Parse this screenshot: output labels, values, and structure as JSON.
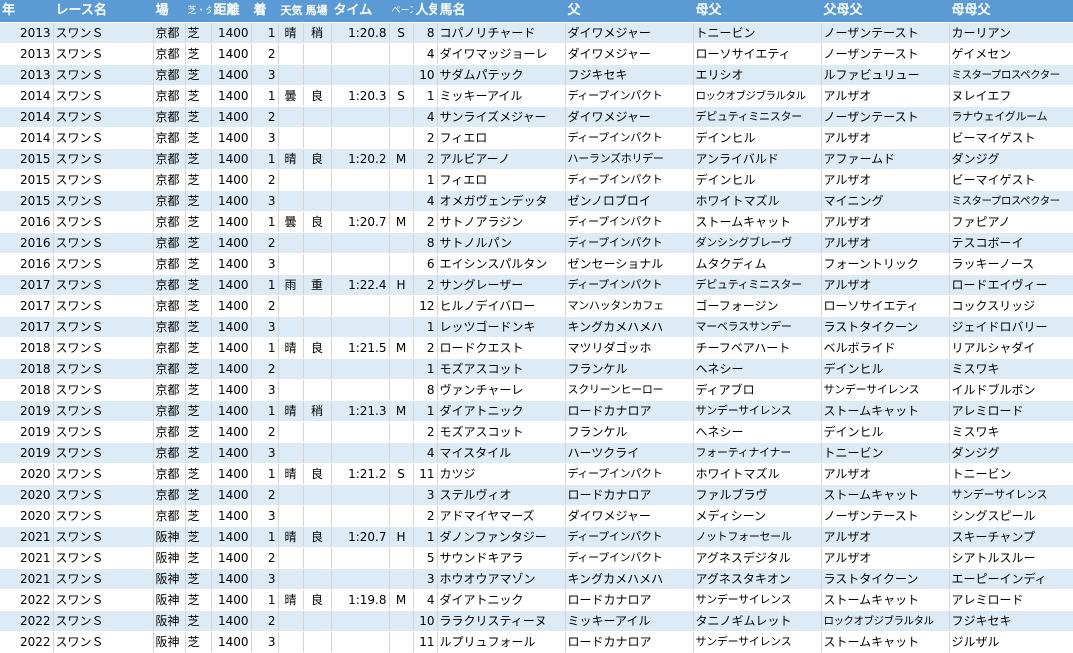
{
  "columns": [
    "年",
    "レース名",
    "場",
    "芝・ダ",
    "距離",
    "着",
    "天気",
    "馬場",
    "タイム",
    "ペース",
    "人気",
    "馬名",
    "父",
    "母父",
    "父母父",
    "母母父"
  ],
  "rows": [
    [
      "2013",
      "スワンＳ",
      "京都",
      "芝",
      "1400",
      "1",
      "晴",
      "稍",
      "1:20.8",
      "S",
      "8",
      "コパノリチャード",
      "ダイワメジャー",
      "トニービン",
      "ノーザンテースト",
      "カーリアン"
    ],
    [
      "2013",
      "スワンＳ",
      "京都",
      "芝",
      "1400",
      "2",
      "",
      "",
      "",
      "",
      "4",
      "ダイワマッジョーレ",
      "ダイワメジャー",
      "ローソサイエティ",
      "ノーザンテースト",
      "ゲイメセン"
    ],
    [
      "2013",
      "スワンＳ",
      "京都",
      "芝",
      "1400",
      "3",
      "",
      "",
      "",
      "",
      "10",
      "サダムパテック",
      "フジキセキ",
      "エリシオ",
      "ルファビュリュー",
      "ミスタープロスペクター"
    ],
    [
      "2014",
      "スワンＳ",
      "京都",
      "芝",
      "1400",
      "1",
      "曇",
      "良",
      "1:20.3",
      "S",
      "1",
      "ミッキーアイル",
      "ディープインパクト",
      "ロックオブジブラルタル",
      "アルザオ",
      "ヌレイエフ"
    ],
    [
      "2014",
      "スワンＳ",
      "京都",
      "芝",
      "1400",
      "2",
      "",
      "",
      "",
      "",
      "4",
      "サンライズメジャー",
      "ダイワメジャー",
      "デピュティミニスター",
      "ノーザンテースト",
      "ラナウェイグルーム"
    ],
    [
      "2014",
      "スワンＳ",
      "京都",
      "芝",
      "1400",
      "3",
      "",
      "",
      "",
      "",
      "2",
      "フィエロ",
      "ディープインパクト",
      "デインヒル",
      "アルザオ",
      "ビーマイゲスト"
    ],
    [
      "2015",
      "スワンＳ",
      "京都",
      "芝",
      "1400",
      "1",
      "晴",
      "良",
      "1:20.2",
      "M",
      "2",
      "アルビアーノ",
      "ハーランズホリデー",
      "アンライバルド",
      "アファームド",
      "ダンジグ"
    ],
    [
      "2015",
      "スワンＳ",
      "京都",
      "芝",
      "1400",
      "2",
      "",
      "",
      "",
      "",
      "1",
      "フィエロ",
      "ディープインパクト",
      "デインヒル",
      "アルザオ",
      "ビーマイゲスト"
    ],
    [
      "2015",
      "スワンＳ",
      "京都",
      "芝",
      "1400",
      "3",
      "",
      "",
      "",
      "",
      "4",
      "オメガヴェンデッタ",
      "ゼンノロブロイ",
      "ホワイトマズル",
      "マイニング",
      "ミスタープロスペクター"
    ],
    [
      "2016",
      "スワンＳ",
      "京都",
      "芝",
      "1400",
      "1",
      "曇",
      "良",
      "1:20.7",
      "M",
      "2",
      "サトノアラジン",
      "ディープインパクト",
      "ストームキャット",
      "アルザオ",
      "ファピアノ"
    ],
    [
      "2016",
      "スワンＳ",
      "京都",
      "芝",
      "1400",
      "2",
      "",
      "",
      "",
      "",
      "8",
      "サトノルパン",
      "ディープインパクト",
      "ダンシングブレーヴ",
      "アルザオ",
      "テスコボーイ"
    ],
    [
      "2016",
      "スワンＳ",
      "京都",
      "芝",
      "1400",
      "3",
      "",
      "",
      "",
      "",
      "6",
      "エイシンスパルタン",
      "ゼンセーショナル",
      "ムタクディム",
      "フォーントリック",
      "ラッキーノース"
    ],
    [
      "2017",
      "スワンＳ",
      "京都",
      "芝",
      "1400",
      "1",
      "雨",
      "重",
      "1:22.4",
      "H",
      "2",
      "サングレーザー",
      "ディープインパクト",
      "デピュティミニスター",
      "アルザオ",
      "ロードエイヴィー"
    ],
    [
      "2017",
      "スワンＳ",
      "京都",
      "芝",
      "1400",
      "2",
      "",
      "",
      "",
      "",
      "12",
      "ヒルノデイバロー",
      "マンハッタンカフェ",
      "ゴーフォージン",
      "ローソサイエティ",
      "コックスリッジ"
    ],
    [
      "2017",
      "スワンＳ",
      "京都",
      "芝",
      "1400",
      "3",
      "",
      "",
      "",
      "",
      "1",
      "レッツゴードンキ",
      "キングカメハメハ",
      "マーベラスサンデー",
      "ラストタイクーン",
      "ジェイドロバリー"
    ],
    [
      "2018",
      "スワンＳ",
      "京都",
      "芝",
      "1400",
      "1",
      "晴",
      "良",
      "1:21.5",
      "M",
      "2",
      "ロードクエスト",
      "マツリダゴッホ",
      "チーフベアハート",
      "ベルボライド",
      "リアルシャダイ"
    ],
    [
      "2018",
      "スワンＳ",
      "京都",
      "芝",
      "1400",
      "2",
      "",
      "",
      "",
      "",
      "1",
      "モズアスコット",
      "フランケル",
      "ヘネシー",
      "デインヒル",
      "ミスワキ"
    ],
    [
      "2018",
      "スワンＳ",
      "京都",
      "芝",
      "1400",
      "3",
      "",
      "",
      "",
      "",
      "8",
      "ヴァンチャーレ",
      "スクリーンヒーロー",
      "ディアブロ",
      "サンデーサイレンス",
      "イルドブルボン"
    ],
    [
      "2019",
      "スワンＳ",
      "京都",
      "芝",
      "1400",
      "1",
      "晴",
      "稍",
      "1:21.3",
      "M",
      "1",
      "ダイアトニック",
      "ロードカナロア",
      "サンデーサイレンス",
      "ストームキャット",
      "アレミロード"
    ],
    [
      "2019",
      "スワンＳ",
      "京都",
      "芝",
      "1400",
      "2",
      "",
      "",
      "",
      "",
      "2",
      "モズアスコット",
      "フランケル",
      "ヘネシー",
      "デインヒル",
      "ミスワキ"
    ],
    [
      "2019",
      "スワンＳ",
      "京都",
      "芝",
      "1400",
      "3",
      "",
      "",
      "",
      "",
      "4",
      "マイスタイル",
      "ハーツクライ",
      "フォーティナイナー",
      "トニービン",
      "ダンジグ"
    ],
    [
      "2020",
      "スワンＳ",
      "京都",
      "芝",
      "1400",
      "1",
      "晴",
      "良",
      "1:21.2",
      "S",
      "11",
      "カツジ",
      "ディープインパクト",
      "ホワイトマズル",
      "アルザオ",
      "トニービン"
    ],
    [
      "2020",
      "スワンＳ",
      "京都",
      "芝",
      "1400",
      "2",
      "",
      "",
      "",
      "",
      "3",
      "ステルヴィオ",
      "ロードカナロア",
      "ファルブラヴ",
      "ストームキャット",
      "サンデーサイレンス"
    ],
    [
      "2020",
      "スワンＳ",
      "京都",
      "芝",
      "1400",
      "3",
      "",
      "",
      "",
      "",
      "2",
      "アドマイヤマーズ",
      "ダイワメジャー",
      "メディシーン",
      "ノーザンテースト",
      "シングスピール"
    ],
    [
      "2021",
      "スワンＳ",
      "阪神",
      "芝",
      "1400",
      "1",
      "晴",
      "良",
      "1:20.7",
      "H",
      "1",
      "ダノンファンタジー",
      "ディープインパクト",
      "ノットフォーセール",
      "アルザオ",
      "スキーチャンプ"
    ],
    [
      "2021",
      "スワンＳ",
      "阪神",
      "芝",
      "1400",
      "2",
      "",
      "",
      "",
      "",
      "5",
      "サウンドキアラ",
      "ディープインパクト",
      "アグネスデジタル",
      "アルザオ",
      "シアトルスルー"
    ],
    [
      "2021",
      "スワンＳ",
      "阪神",
      "芝",
      "1400",
      "3",
      "",
      "",
      "",
      "",
      "3",
      "ホウオウアマゾン",
      "キングカメハメハ",
      "アグネスタキオン",
      "ラストタイクーン",
      "エーピーインディ"
    ],
    [
      "2022",
      "スワンＳ",
      "阪神",
      "芝",
      "1400",
      "1",
      "晴",
      "良",
      "1:19.8",
      "M",
      "4",
      "ダイアトニック",
      "ロードカナロア",
      "サンデーサイレンス",
      "ストームキャット",
      "アレミロード"
    ],
    [
      "2022",
      "スワンＳ",
      "阪神",
      "芝",
      "1400",
      "2",
      "",
      "",
      "",
      "",
      "10",
      "ララクリスティーヌ",
      "ミッキーアイル",
      "タニノギムレット",
      "ロックオブジブラルタル",
      "フジキセキ"
    ],
    [
      "2022",
      "スワンＳ",
      "阪神",
      "芝",
      "1400",
      "3",
      "",
      "",
      "",
      "",
      "11",
      "ルプリュフォール",
      "ロードカナロア",
      "サンデーサイレンス",
      "ストームキャット",
      "ジルザル"
    ]
  ]
}
